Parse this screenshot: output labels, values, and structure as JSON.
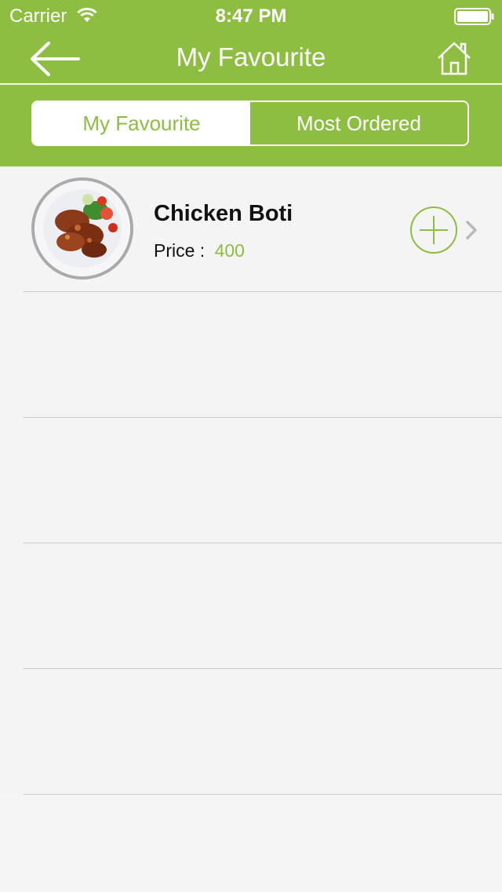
{
  "status_bar": {
    "carrier": "Carrier",
    "time": "8:47 PM"
  },
  "nav": {
    "title": "My Favourite",
    "back_icon": "arrow-left-icon",
    "home_icon": "home-icon"
  },
  "tabs": [
    {
      "label": "My Favourite",
      "selected": true
    },
    {
      "label": "Most Ordered",
      "selected": false
    }
  ],
  "items": [
    {
      "name": "Chicken Boti",
      "price_label": "Price :",
      "price": "400"
    }
  ],
  "colors": {
    "accent": "#8dbd41",
    "background": "#f4f5f4",
    "separator": "#c8c8c8"
  }
}
